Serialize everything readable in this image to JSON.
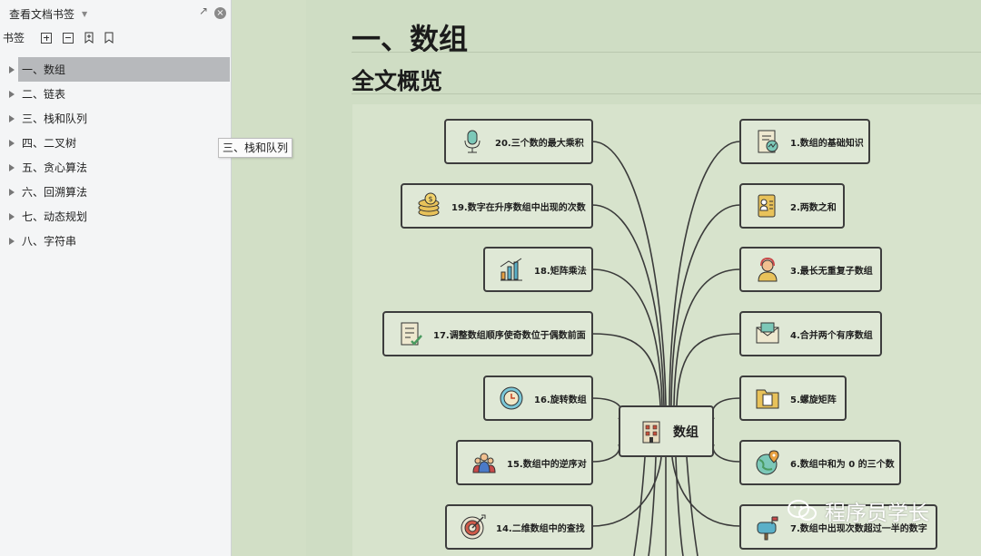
{
  "sidebar": {
    "title": "查看文档书签",
    "toolbar_label": "书签",
    "items": [
      {
        "label": "一、数组",
        "selected": true
      },
      {
        "label": "二、链表"
      },
      {
        "label": "三、栈和队列"
      },
      {
        "label": "四、二叉树"
      },
      {
        "label": "五、贪心算法"
      },
      {
        "label": "六、回溯算法"
      },
      {
        "label": "七、动态规划"
      },
      {
        "label": "八、字符串"
      }
    ]
  },
  "tooltip": "三、栈和队列",
  "doc": {
    "heading1": "一、数组",
    "heading2": "全文概览"
  },
  "mindmap": {
    "center": "数组",
    "left": [
      {
        "label": "20.三个数的最大乘积",
        "icon": "microphone-icon"
      },
      {
        "label": "19.数字在升序数组中出现的次数",
        "icon": "coins-icon"
      },
      {
        "label": "18.矩阵乘法",
        "icon": "bar-chart-icon"
      },
      {
        "label": "17.调整数组顺序使奇数位于偶数前面",
        "icon": "checklist-icon"
      },
      {
        "label": "16.旋转数组",
        "icon": "clock-icon"
      },
      {
        "label": "15.数组中的逆序对",
        "icon": "people-icon"
      },
      {
        "label": "14.二维数组中的查找",
        "icon": "target-icon"
      }
    ],
    "right": [
      {
        "label": "1.数组的基础知识",
        "icon": "document-chart-icon"
      },
      {
        "label": "2.两数之和",
        "icon": "id-card-icon"
      },
      {
        "label": "3.最长无重复子数组",
        "icon": "support-agent-icon"
      },
      {
        "label": "4.合并两个有序数组",
        "icon": "envelope-icon"
      },
      {
        "label": "5.螺旋矩阵",
        "icon": "folder-icon"
      },
      {
        "label": "6.数组中和为 0 的三个数",
        "icon": "globe-pin-icon"
      },
      {
        "label": "7.数组中出现次数超过一半的数字",
        "icon": "mailbox-icon"
      }
    ]
  },
  "watermark": "程序员学长"
}
